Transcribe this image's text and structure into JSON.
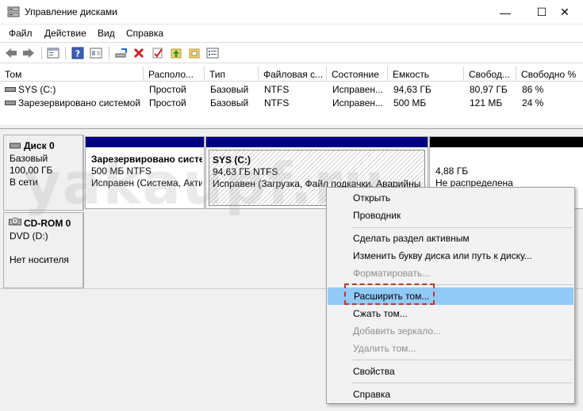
{
  "window": {
    "title": "Управление дисками",
    "minimize": "—",
    "maximize": "☐",
    "close": "✕"
  },
  "menu": [
    "Файл",
    "Действие",
    "Вид",
    "Справка"
  ],
  "toolbar_icons": [
    "back-icon",
    "forward-icon",
    "properties-icon",
    "help-icon",
    "show-hide-icon",
    "connect-icon",
    "delete-icon",
    "check-icon",
    "up-icon",
    "rescan-icon"
  ],
  "columns": [
    "Том",
    "Располо...",
    "Тип",
    "Файловая с...",
    "Состояние",
    "Емкость",
    "Свобод...",
    "Свободно %"
  ],
  "volumes": [
    {
      "name": "SYS (C:)",
      "layout": "Простой",
      "type": "Базовый",
      "fs": "NTFS",
      "status": "Исправен...",
      "capacity": "94,63 ГБ",
      "free": "80,97 ГБ",
      "free_pct": "86 %"
    },
    {
      "name": "Зарезервировано системой",
      "layout": "Простой",
      "type": "Базовый",
      "fs": "NTFS",
      "status": "Исправен...",
      "capacity": "500 МБ",
      "free": "121 МБ",
      "free_pct": "24 %"
    }
  ],
  "disk0": {
    "name": "Диск 0",
    "type": "Базовый",
    "size": "100,00 ГБ",
    "status": "В сети"
  },
  "partitions": [
    {
      "title": "Зарезервировано систе",
      "size": "500 МБ NTFS",
      "status": "Исправен (Система, Акти",
      "bar_color": "#00007f"
    },
    {
      "title": "SYS (C:)",
      "size": "94,63 ГБ NTFS",
      "status": "Исправен (Загрузка, Файл подкачки, Аварийны",
      "bar_color": "#00007f"
    },
    {
      "size": "4,88 ГБ",
      "status": "Не распределена",
      "bar_color": "#000000"
    }
  ],
  "cdrom0": {
    "name": "CD-ROM 0",
    "drive": "DVD (D:)",
    "status": "Нет носителя"
  },
  "watermark": "yakaupf.ru",
  "context_menu": {
    "items": [
      {
        "label": "Открыть",
        "disabled": false
      },
      {
        "label": "Проводник",
        "disabled": false
      },
      {
        "label": "Сделать раздел активным",
        "disabled": false
      },
      {
        "label": "Изменить букву диска или путь к диску...",
        "disabled": false
      },
      {
        "label": "Форматировать...",
        "disabled": true
      },
      {
        "label": "Расширить том...",
        "disabled": false,
        "highlighted": true
      },
      {
        "label": "Сжать том...",
        "disabled": false
      },
      {
        "label": "Добавить зеркало...",
        "disabled": true
      },
      {
        "label": "Удалить том...",
        "disabled": true
      },
      {
        "label": "Свойства",
        "disabled": false
      },
      {
        "label": "Справка",
        "disabled": false
      }
    ]
  },
  "colors": {
    "partition_bar_allocated": "#00007f",
    "partition_bar_unallocated": "#000000",
    "menu_highlight": "#91c9f7",
    "annotation_dash": "#c0392b"
  }
}
